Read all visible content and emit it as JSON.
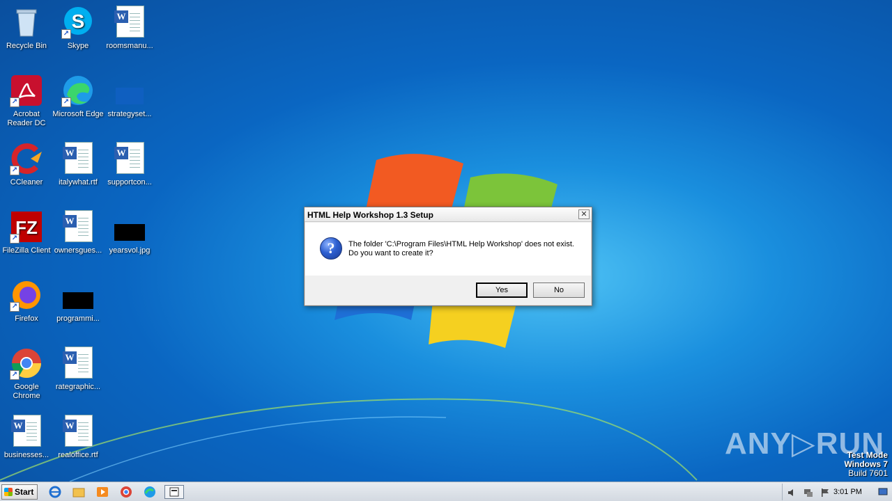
{
  "desktop": {
    "icons": [
      {
        "label": "Recycle Bin"
      },
      {
        "label": "Skype"
      },
      {
        "label": "roomsmanu..."
      },
      {
        "label": "Acrobat Reader DC"
      },
      {
        "label": "Microsoft Edge"
      },
      {
        "label": "strategyset..."
      },
      {
        "label": "CCleaner"
      },
      {
        "label": "italywhat.rtf"
      },
      {
        "label": "supportcon..."
      },
      {
        "label": "FileZilla Client"
      },
      {
        "label": "ownersgues..."
      },
      {
        "label": "yearsvol.jpg"
      },
      {
        "label": "Firefox"
      },
      {
        "label": "programmi..."
      },
      {
        "label": "Google Chrome"
      },
      {
        "label": "rategraphic..."
      },
      {
        "label": "businesses..."
      },
      {
        "label": "realoffice.rtf"
      }
    ]
  },
  "dialog": {
    "title": "HTML Help Workshop 1.3 Setup",
    "close_glyph": "✕",
    "question_glyph": "?",
    "message_line1": "The folder 'C:\\Program Files\\HTML Help Workshop' does not exist.",
    "message_line2": "Do you want to create it?",
    "yes_label": "Yes",
    "no_label": "No"
  },
  "watermark": {
    "brand": "ANY▷RUN",
    "line1": "Test Mode",
    "line2": "Windows 7",
    "line3": "Build 7601"
  },
  "taskbar": {
    "start_label": "Start",
    "clock": "3:01 PM"
  },
  "colors": {
    "desktop_bg": "#0a66c2",
    "taskbar_bg": "#d3d9e1",
    "dialog_bg": "#f0f0f0"
  }
}
